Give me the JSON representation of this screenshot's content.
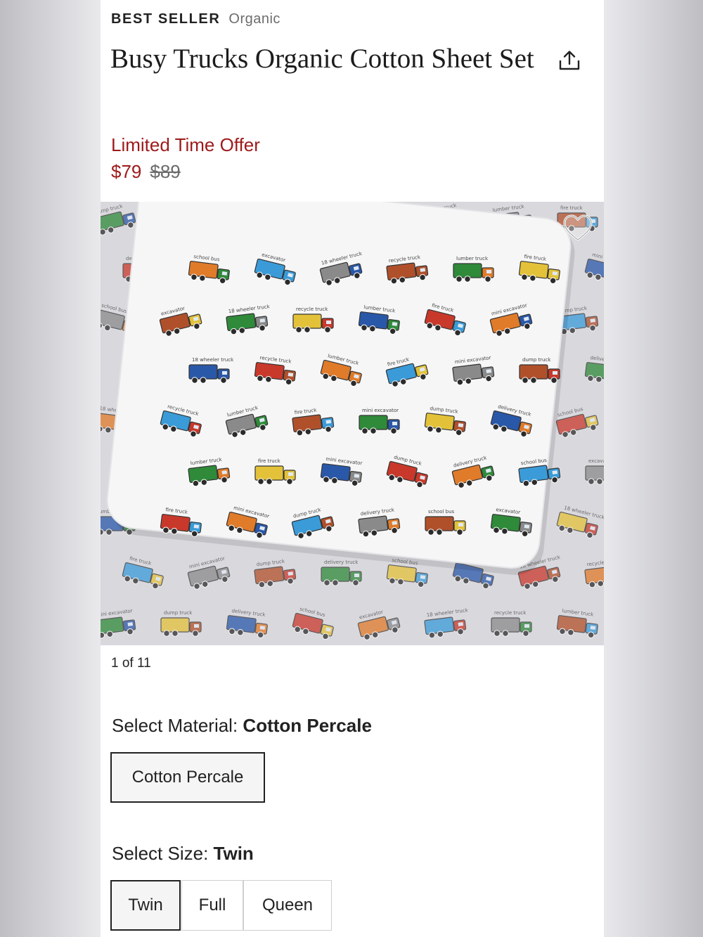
{
  "product": {
    "badge": "BEST SELLER",
    "tag": "Organic",
    "title": "Busy Trucks Organic Cotton Sheet Set",
    "offer_label": "Limited Time Offer",
    "price": "$79",
    "original_price": "$89"
  },
  "gallery": {
    "counter": "1 of 11",
    "image_alt": "Busy Trucks sheet set with pillowcase",
    "fabric_print_words": [
      "dump truck",
      "delivery truck",
      "school bus",
      "excavator",
      "18 wheeler truck",
      "recycle truck",
      "lumber truck",
      "fire truck",
      "mini excavator"
    ]
  },
  "material": {
    "label": "Select Material:",
    "selected": "Cotton Percale",
    "options": [
      "Cotton Percale"
    ]
  },
  "size": {
    "label": "Select Size:",
    "selected": "Twin",
    "options": [
      "Twin",
      "Full",
      "Queen"
    ]
  },
  "colors": {
    "sale_red": "#9e1a1a",
    "text": "#222222",
    "muted": "#6c6c6c"
  },
  "icons": [
    "share-icon",
    "heart-icon"
  ]
}
